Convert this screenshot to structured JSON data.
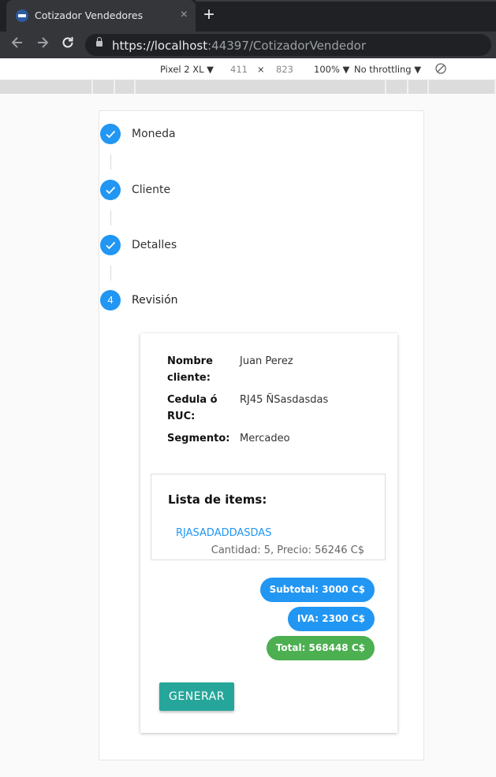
{
  "browser": {
    "tab_title": "Cotizador Vendedores",
    "tab_close": "×",
    "new_tab": "+",
    "url_host": "https://localhost",
    "url_rest": ":44397/CotizadorVendedor"
  },
  "devtools": {
    "device": "Pixel 2 XL ▼",
    "width": "411",
    "times": "×",
    "height": "823",
    "zoom": "100% ▼",
    "throttle": "No throttling ▼"
  },
  "stepper": {
    "steps": [
      {
        "label": "Moneda",
        "icon": "check-icon"
      },
      {
        "label": "Cliente",
        "icon": "check-icon"
      },
      {
        "label": "Detalles",
        "icon": "check-icon"
      },
      {
        "label": "Revisión",
        "number": "4"
      }
    ]
  },
  "review": {
    "nombre_label": "Nombre cliente:",
    "nombre_value": "Juan Perez",
    "cedula_label": "Cedula ó RUC:",
    "cedula_value": "RJ45 ÑSasdasdas",
    "segmento_label": "Segmento:",
    "segmento_value": "Mercadeo",
    "items_title": "Lista de items:",
    "items": [
      {
        "name": "RJASADADDASDAS",
        "detail": "Cantidad: 5, Precio: 56246 C$"
      }
    ],
    "subtotal": "Subtotal: 3000 C$",
    "iva": "IVA: 2300 C$",
    "total": "Total: 568448 C$",
    "generate_button": "GENERAR"
  },
  "colors": {
    "primary": "#2196f3",
    "success": "#4caf50",
    "teal": "#26a69a"
  }
}
